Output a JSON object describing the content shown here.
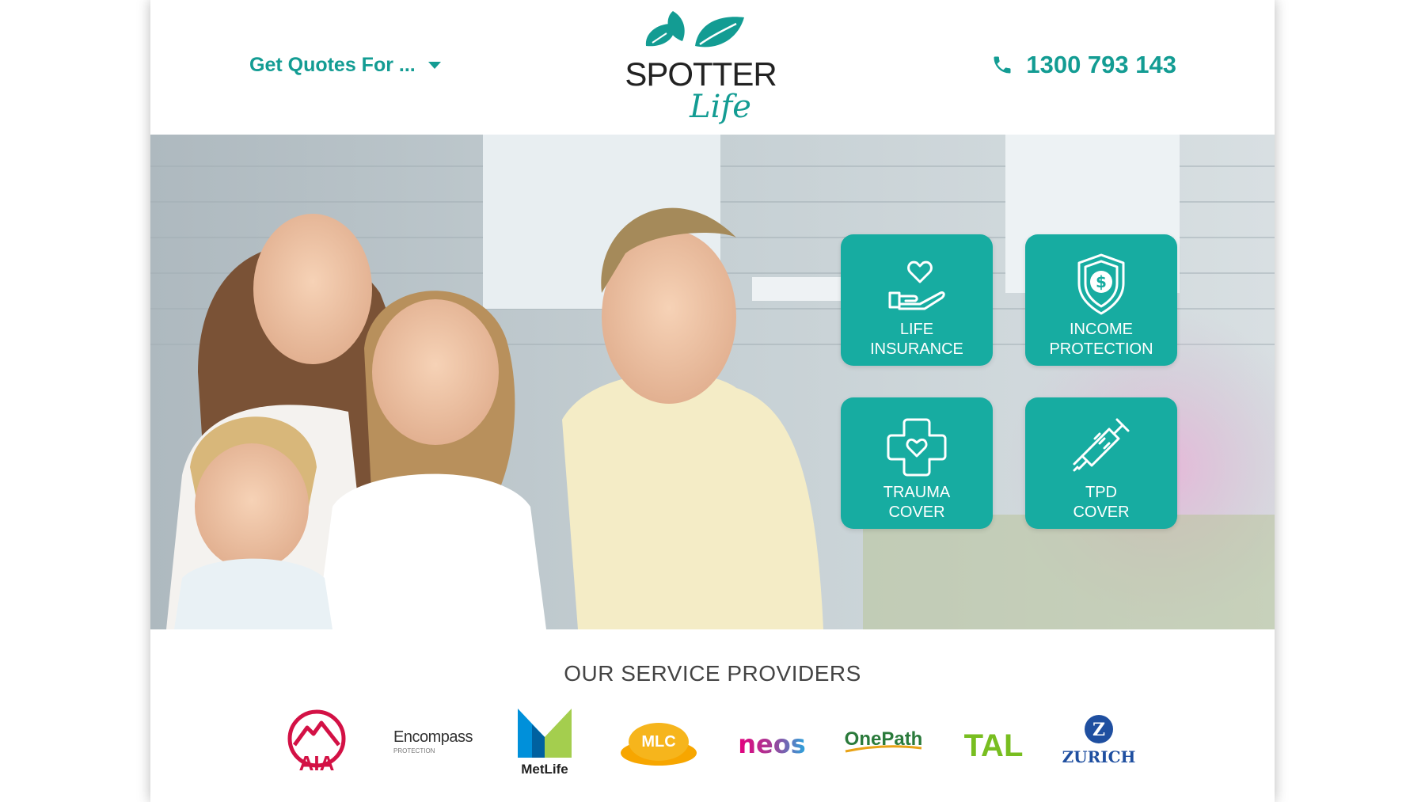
{
  "header": {
    "quotes_label": "Get Quotes For ...",
    "phone": "1300 793 143",
    "logo": {
      "brand": "SPOTTER",
      "sub": "Life"
    }
  },
  "hero": {
    "tiles": [
      {
        "label": "LIFE\nINSURANCE",
        "icon": "heart-hand-icon"
      },
      {
        "label": "INCOME\nPROTECTION",
        "icon": "dollar-shield-icon"
      },
      {
        "label": "TRAUMA\nCOVER",
        "icon": "heart-cross-icon"
      },
      {
        "label": "TPD\nCOVER",
        "icon": "syringe-icon"
      }
    ]
  },
  "providers": {
    "title": "OUR SERVICE PROVIDERS",
    "logos": [
      {
        "name": "AIA",
        "text": "AIA"
      },
      {
        "name": "Encompass",
        "text": "Encompass",
        "sub": "PROTECTION"
      },
      {
        "name": "MetLife",
        "text": "MetLife"
      },
      {
        "name": "MLC",
        "text": "MLC"
      },
      {
        "name": "NEOS",
        "text": "neos"
      },
      {
        "name": "OnePath",
        "text": "OnePath"
      },
      {
        "name": "TAL",
        "text": "TAL"
      },
      {
        "name": "Zurich",
        "text": "ZURICH",
        "mark": "Z"
      }
    ]
  },
  "colors": {
    "accent": "#139c93",
    "tile": "#17aca1"
  }
}
